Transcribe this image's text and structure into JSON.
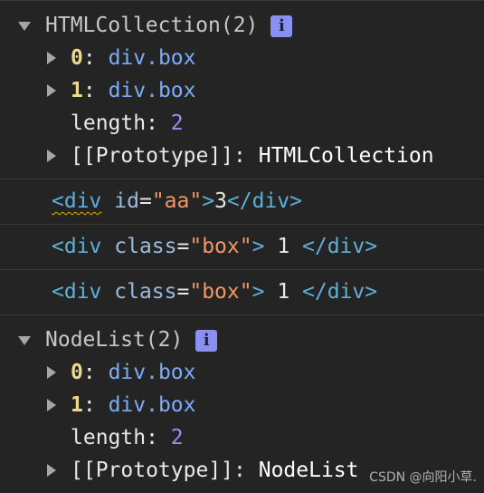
{
  "collection": {
    "header": "HTMLCollection(2)",
    "info_icon": "i",
    "items": [
      {
        "index": "0",
        "value": "div.box"
      },
      {
        "index": "1",
        "value": "div.box"
      }
    ],
    "length_key": "length",
    "length_value": "2",
    "proto_key": "[[Prototype]]",
    "proto_value": "HTMLCollection"
  },
  "html_lines": [
    {
      "open": "<div",
      "attr": "id",
      "eq": "=",
      "attr_value": "\"aa\"",
      "close_open": ">",
      "text": "3",
      "end_tag": "</div>"
    },
    {
      "open": "<div",
      "attr": "class",
      "eq": "=",
      "attr_value": "\"box\"",
      "close_open": ">",
      "text": " 1 ",
      "end_tag": "</div>"
    },
    {
      "open": "<div",
      "attr": "class",
      "eq": "=",
      "attr_value": "\"box\"",
      "close_open": ">",
      "text": " 1 ",
      "end_tag": "</div>"
    }
  ],
  "nodelist": {
    "header": "NodeList(2)",
    "info_icon": "i",
    "items": [
      {
        "index": "0",
        "value": "div.box"
      },
      {
        "index": "1",
        "value": "div.box"
      }
    ],
    "length_key": "length",
    "length_value": "2",
    "proto_key": "[[Prototype]]",
    "proto_value": "NodeList"
  },
  "watermark": "CSDN @向阳小草."
}
